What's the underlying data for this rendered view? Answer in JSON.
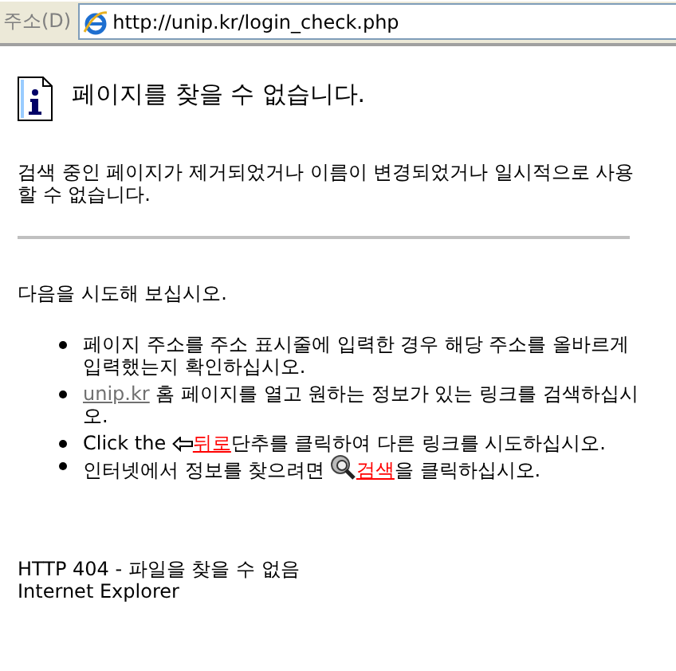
{
  "address_bar": {
    "label": "주소(D)",
    "url": "http://unip.kr/login_check.php"
  },
  "title": "페이지를 찾을 수 없습니다.",
  "description": "검색 중인 페이지가 제거되었거나 이름이 변경되었거나 일시적으로 사용할 수 없습니다.",
  "intro": "다음을 시도해 보십시오.",
  "suggestions": [
    {
      "parts": [
        {
          "kind": "text",
          "text": "페이지 주소를 주소 표시줄에 입력한 경우 해당 주소를 올바르게 입력했는지 확인하십시오."
        }
      ]
    },
    {
      "parts": [
        {
          "kind": "link",
          "text": "unip.kr"
        },
        {
          "kind": "text",
          "text": "  홈 페이지를 열고 원하는 정보가 있는 링크를 검색하십시오."
        }
      ]
    },
    {
      "parts": [
        {
          "kind": "text",
          "text": "Click the "
        },
        {
          "kind": "back_icon"
        },
        {
          "kind": "action_link",
          "text": "뒤로"
        },
        {
          "kind": "text",
          "text": "단추를 클릭하여 다른 링크를 시도하십시오."
        }
      ]
    },
    {
      "parts": [
        {
          "kind": "text",
          "text": "인터넷에서 정보를 찾으려면 "
        },
        {
          "kind": "search_icon"
        },
        {
          "kind": "action_link",
          "text": "검색"
        },
        {
          "kind": "text",
          "text": "을 클릭하십시오."
        }
      ]
    }
  ],
  "footer": [
    "HTTP 404 - 파일을 찾을 수 없음",
    "Internet Explorer"
  ]
}
